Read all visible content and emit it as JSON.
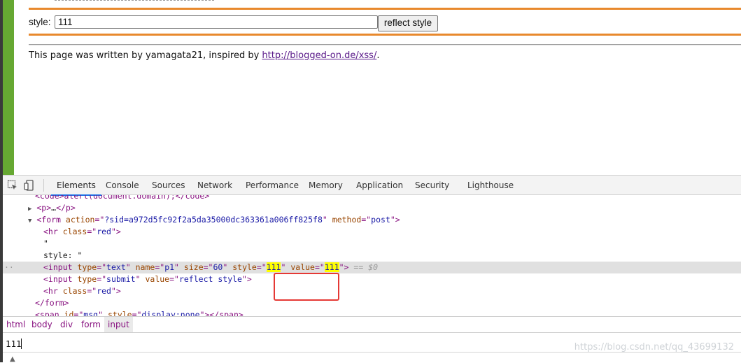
{
  "page": {
    "style_label": "style:",
    "style_value": "111",
    "reflect_button": "reflect style",
    "credit_prefix": "This page was written by yamagata21, inspired by ",
    "credit_link": "http://blogged-on.de/xss/",
    "credit_suffix": "."
  },
  "devtools": {
    "tabs": [
      "Elements",
      "Console",
      "Sources",
      "Network",
      "Performance",
      "Memory",
      "Application",
      "Security",
      "Lighthouse"
    ],
    "active_tab": "Elements",
    "dom": {
      "line0": "<code>alert(document.domain);</code>",
      "line1_open": "<p>",
      "line1_ellipsis": "…",
      "line1_close": "</p>",
      "form_action": "?sid=a972d5fc92f2a5da35000dc363361a006ff825f8",
      "form_method": "post",
      "hr_class": "red",
      "quote": "\"",
      "style_text": "style: \"",
      "input_type": "text",
      "input_name": "p1",
      "input_size": "60",
      "input_style": "111",
      "input_value": "111",
      "selected_marker": "== $0",
      "submit_type": "submit",
      "submit_value": "reflect style",
      "span_id": "msg",
      "span_style": "display:none"
    },
    "breadcrumb": [
      "html",
      "body",
      "div",
      "form",
      "input"
    ],
    "breadcrumb_active": "input",
    "console_value": "111",
    "watermark": "https://blog.csdn.net/qq_43699132"
  },
  "colors": {
    "accent_orange": "#e8892d",
    "tab_underline": "#1a73e8",
    "tag": "#881280",
    "highlight": "#ffff00",
    "annotation_box": "#e53935"
  }
}
